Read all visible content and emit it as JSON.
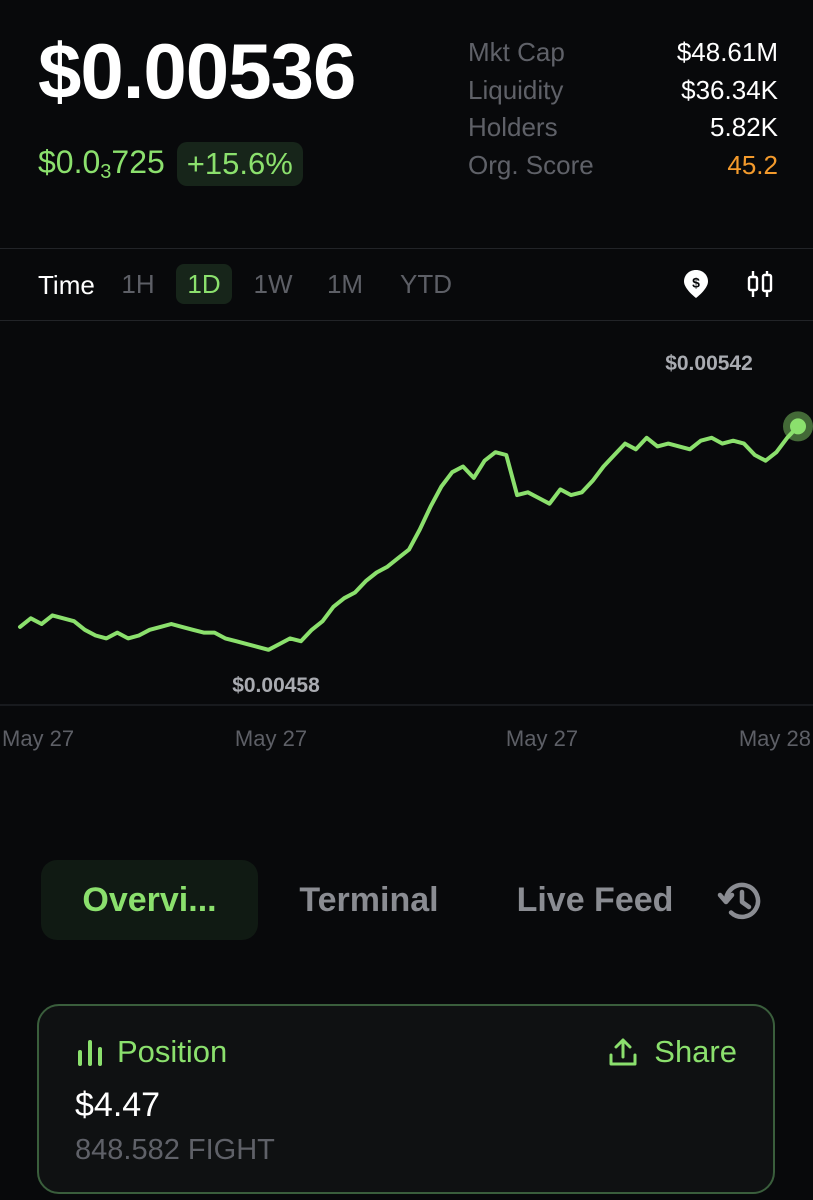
{
  "header": {
    "price": "$0.00536",
    "sub_price_prefix": "$0.0",
    "sub_price_zeros": "3",
    "sub_price_suffix": "725",
    "change_badge": "+15.6%"
  },
  "stats": [
    {
      "label": "Mkt Cap",
      "value": "$48.61M"
    },
    {
      "label": "Liquidity",
      "value": "$36.34K"
    },
    {
      "label": "Holders",
      "value": "5.82K"
    },
    {
      "label": "Org. Score",
      "value": "45.2"
    }
  ],
  "range": {
    "label": "Time",
    "options": [
      "1H",
      "1D",
      "1W",
      "1M",
      "YTD"
    ],
    "selected": "1D",
    "icons": [
      "dollar-pin-icon",
      "candlestick-icon"
    ]
  },
  "chart_data": {
    "type": "line",
    "color": "#8be06d",
    "high_label": "$0.00542",
    "low_label": "$0.00458",
    "x_ticks": [
      "May 27",
      "May 27",
      "May 27",
      "May 28"
    ],
    "ylim": [
      0.00452,
      0.00548
    ],
    "series": [
      {
        "values": [
          0.00466,
          0.00469,
          0.00467,
          0.0047,
          0.00469,
          0.00468,
          0.00465,
          0.00463,
          0.00462,
          0.00464,
          0.00462,
          0.00463,
          0.00465,
          0.00466,
          0.00467,
          0.00466,
          0.00465,
          0.00464,
          0.00464,
          0.00462,
          0.00461,
          0.0046,
          0.00459,
          0.00458,
          0.0046,
          0.00462,
          0.00461,
          0.00465,
          0.00468,
          0.00473,
          0.00476,
          0.00478,
          0.00482,
          0.00485,
          0.00487,
          0.0049,
          0.00493,
          0.005,
          0.00508,
          0.00515,
          0.0052,
          0.00522,
          0.00518,
          0.00524,
          0.00527,
          0.00526,
          0.00512,
          0.00513,
          0.00511,
          0.00509,
          0.00514,
          0.00512,
          0.00513,
          0.00517,
          0.00522,
          0.00526,
          0.0053,
          0.00528,
          0.00532,
          0.00529,
          0.0053,
          0.00529,
          0.00528,
          0.00531,
          0.00532,
          0.0053,
          0.00531,
          0.0053,
          0.00526,
          0.00524,
          0.00527,
          0.00532,
          0.00536
        ]
      }
    ]
  },
  "tabs": {
    "items": [
      "Overvi...",
      "Terminal",
      "Live Feed"
    ],
    "active": "Overvi...",
    "history_icon": "history-icon"
  },
  "position": {
    "title": "Position",
    "share_label": "Share",
    "value": "$4.47",
    "amount": "848.582 FIGHT"
  }
}
